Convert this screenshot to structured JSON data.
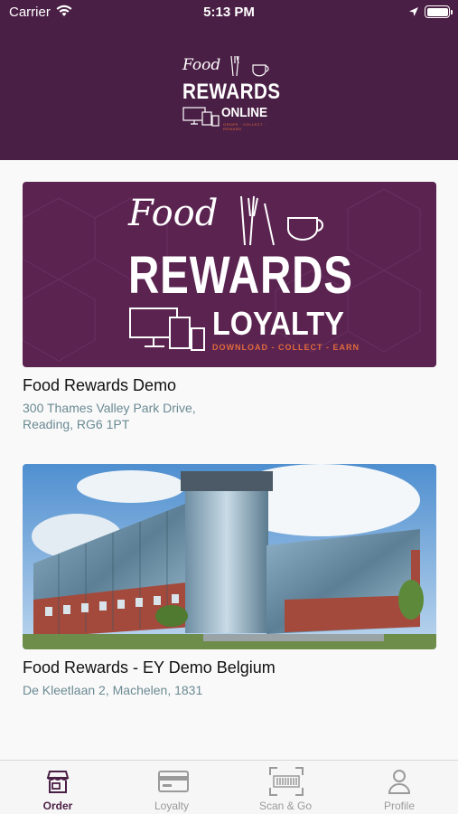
{
  "status_bar": {
    "carrier": "Carrier",
    "time": "5:13 PM"
  },
  "header": {
    "logo": {
      "line1": "Food",
      "line2": "REWARDS",
      "line3": "ONLINE",
      "tagline": "ORDER · COLLECT · REWARD"
    }
  },
  "venues": [
    {
      "banner": {
        "line1": "Food",
        "line2": "REWARDS",
        "line3": "LOYALTY",
        "tagline": "DOWNLOAD - COLLECT - EARN"
      },
      "name": "Food Rewards Demo",
      "address_line1": "300 Thames Valley Park Drive,",
      "address_line2": "Reading, RG6 1PT"
    },
    {
      "image": "office-building-photo",
      "name": "Food Rewards - EY Demo Belgium",
      "address_line1": "De Kleetlaan 2, Machelen, 1831"
    }
  ],
  "tabs": [
    {
      "label": "Order",
      "icon": "storefront-icon",
      "active": true
    },
    {
      "label": "Loyalty",
      "icon": "card-icon",
      "active": false
    },
    {
      "label": "Scan & Go",
      "icon": "barcode-scan-icon",
      "active": false
    },
    {
      "label": "Profile",
      "icon": "person-icon",
      "active": false
    }
  ],
  "colors": {
    "brand_purple": "#4a1f45",
    "accent_orange": "#e06a3c",
    "address_text": "#6a8a93"
  }
}
